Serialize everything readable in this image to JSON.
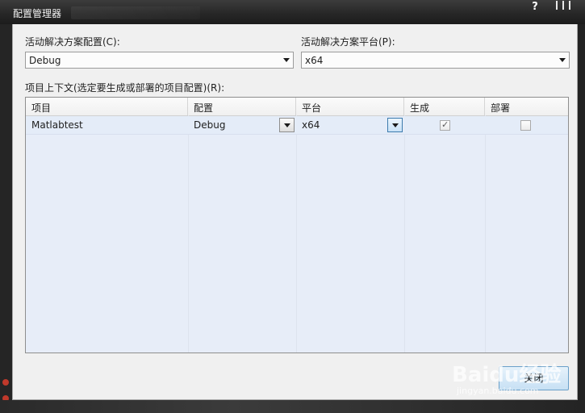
{
  "window": {
    "title": "配置管理器",
    "help_label": "?",
    "close_label": "关闭"
  },
  "active_config": {
    "label": "活动解决方案配置(C):",
    "value": "Debug"
  },
  "active_platform": {
    "label": "活动解决方案平台(P):",
    "value": "x64"
  },
  "contexts": {
    "label": "项目上下文(选定要生成或部署的项目配置)(R):",
    "columns": [
      "项目",
      "配置",
      "平台",
      "生成",
      "部署"
    ],
    "rows": [
      {
        "project": "Matlabtest",
        "config": "Debug",
        "platform": "x64",
        "build": true,
        "deploy": false
      }
    ]
  },
  "watermark": {
    "logo": "Baidu经验",
    "sub": "jingyan.baidu.com"
  }
}
